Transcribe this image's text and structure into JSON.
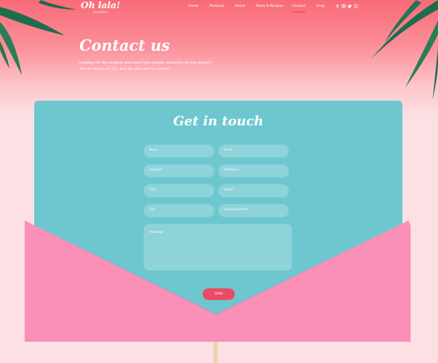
{
  "brand": {
    "logo": "Oh lala!",
    "tagline": "Smoothie"
  },
  "nav": {
    "items": [
      "Home",
      "Products",
      "About",
      "News & Recipes",
      "Contact",
      "Shop"
    ],
    "active_index": 4
  },
  "social_icons": [
    "facebook-icon",
    "instagram-icon",
    "twitter-icon",
    "pinterest-icon"
  ],
  "hero": {
    "title": "Contact us",
    "line1": "Looking for the original and best high-protein smoothie on the planet?",
    "line2": "You've found us! Oh, and we also sell ice cream."
  },
  "form": {
    "title": "Get in touch",
    "fields": {
      "name": "Name",
      "email": "Email",
      "address": "Address*",
      "address2": "Address 2",
      "city": "City*",
      "state": "State*",
      "zip": "Zip*",
      "phone": "Phone Number*",
      "message": "Message"
    },
    "send_label": "SEND"
  },
  "colors": {
    "hero_top": "#f96a78",
    "page_bg": "#fde0e3",
    "card": "#6ec7cf",
    "envelope": "#fa8fb8",
    "button": "#e94b65"
  }
}
